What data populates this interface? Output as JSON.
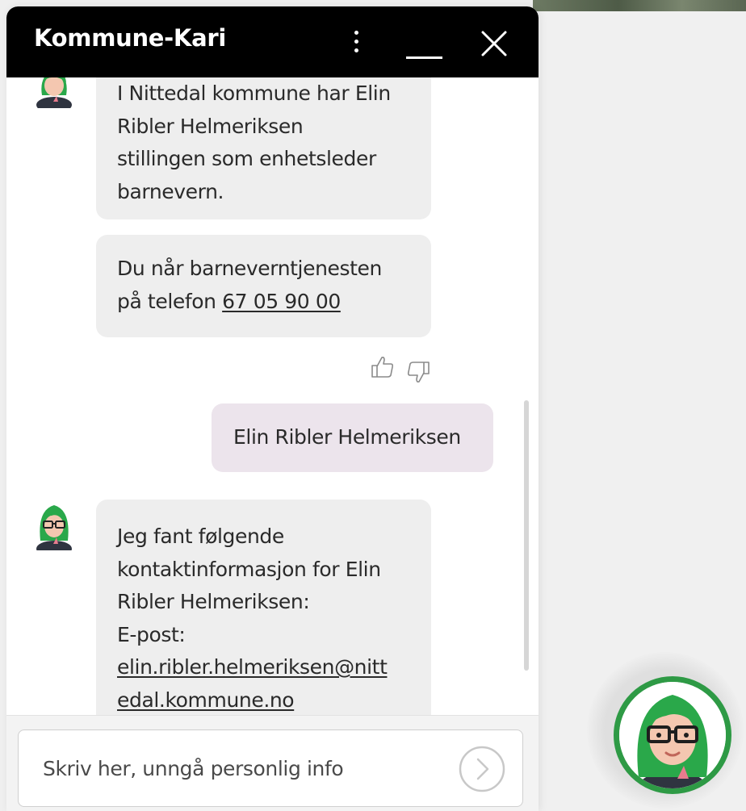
{
  "chat": {
    "title": "Kommune-Kari",
    "messages": [
      {
        "from": "bot",
        "lines": [
          "I Nittedal kommune har Elin",
          "Ribler Helmeriksen",
          "stillingen som enhetsleder",
          "barnevern."
        ]
      },
      {
        "from": "bot",
        "line1": "Du når barneverntjenesten",
        "line2_prefix": "på telefon ",
        "phone": "67 05 90 00"
      },
      {
        "from": "user",
        "text": "Elin Ribler Helmeriksen"
      },
      {
        "from": "bot",
        "lines": [
          "Jeg fant følgende",
          "kontaktinformasjon for Elin",
          "Ribler Helmeriksen:",
          "E-post:"
        ],
        "email_part1": "elin.ribler.helmeriksen@nitt",
        "email_part2": "edal.kommune.no"
      }
    ]
  },
  "input": {
    "placeholder": "Skriv her, unngå personlig info"
  },
  "icons": {
    "menu": "vertical-dots-icon",
    "minimize": "minimize-icon",
    "close": "close-icon",
    "thumbs_up": "thumbs-up-icon",
    "thumbs_down": "thumbs-down-icon",
    "send": "send-arrow-icon",
    "avatar": "kari-avatar-icon"
  },
  "colors": {
    "header": "#000000",
    "bot_bubble": "#eeeeee",
    "user_bubble": "#ece4ec",
    "launcher_ring": "#2e9a45",
    "avatar_hair": "#2aa84a"
  }
}
